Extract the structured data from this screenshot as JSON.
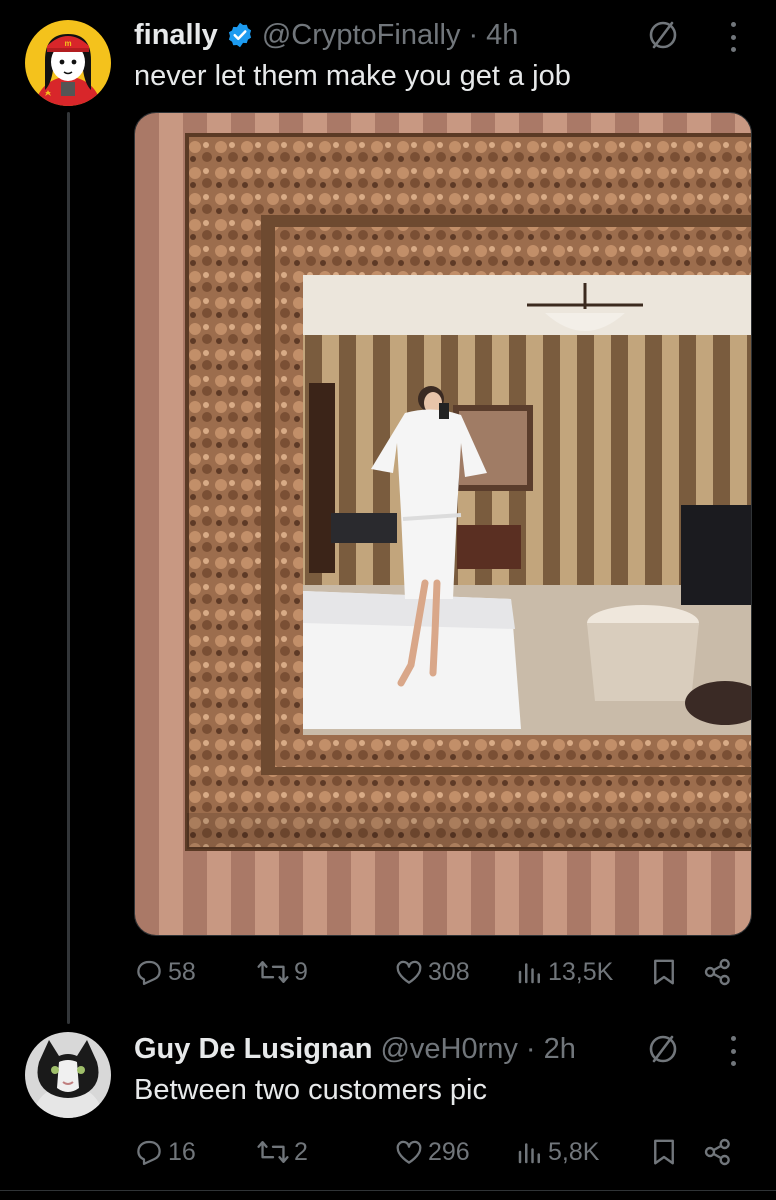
{
  "tweet": {
    "name": "finally",
    "handle": "@CryptoFinally",
    "separator": "·",
    "time": "4h",
    "text": "never let them make you get a job",
    "media_alt": "mirror selfie photo",
    "stats": {
      "replies": "58",
      "reposts": "9",
      "likes": "308",
      "views": "13,5K"
    }
  },
  "reply": {
    "name": "Guy De Lusignan",
    "handle": "@veH0rny",
    "separator": "·",
    "time": "2h",
    "text": "Between two customers pic",
    "stats": {
      "replies": "16",
      "reposts": "2",
      "likes": "296",
      "views": "5,8K"
    }
  },
  "colors": {
    "background": "#000000",
    "text": "#e7e9ea",
    "muted": "#71767b",
    "verified": "#1d9bf0"
  },
  "icons": [
    "verified-badge-icon",
    "grok-icon",
    "more-icon",
    "reply-icon",
    "repost-icon",
    "like-icon",
    "views-icon",
    "bookmark-icon",
    "share-icon"
  ]
}
